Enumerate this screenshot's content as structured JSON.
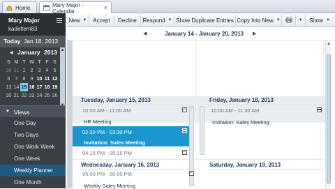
{
  "tabs": [
    {
      "label": "Home",
      "icon": "home-icon"
    },
    {
      "label": "Mary Major - Calendar",
      "icon": "calendar-icon",
      "close": "×"
    }
  ],
  "user": {
    "name": "Mary Major",
    "id": "kadeltem83"
  },
  "datebar": {
    "today_label": "Today",
    "date": "Jan 18, 2013"
  },
  "minical": {
    "month": "January",
    "year": "2013",
    "prev": "◀",
    "dow": [
      "S",
      "M",
      "T",
      "W",
      "T",
      "F",
      "S"
    ],
    "rows": [
      [
        "30",
        "31",
        "1",
        "2",
        "3",
        "4",
        "5"
      ],
      [
        "6",
        "7",
        "8",
        "9",
        "10",
        "11",
        "12"
      ],
      [
        "13",
        "14",
        "15",
        "16",
        "17",
        "18",
        "19"
      ],
      [
        "20",
        "21",
        "22",
        "23",
        "24",
        "25",
        "26"
      ]
    ]
  },
  "views": {
    "heading": "Views",
    "items": [
      "One Day",
      "Two Days",
      "One Work Week",
      "One Week",
      "Weekly Planner",
      "One Month"
    ]
  },
  "toolbar": {
    "new": "New",
    "accept": "Accept",
    "decline": "Decline",
    "respond": "Respond",
    "show_dup": "Show Duplicate Entries",
    "copy_into_new": "Copy Into New",
    "show": "Show"
  },
  "main": {
    "range_title": "January 14 - January 20, 2013",
    "prev": "◀",
    "next": "▶"
  },
  "days": {
    "tue": {
      "label": "Tuesday, January 15, 2013"
    },
    "fri": {
      "label": "Friday, January 18, 2013"
    },
    "wed": {
      "label": "Wednesday, January 16, 2013"
    },
    "sat": {
      "label": "Saturday, January 19, 2013"
    }
  },
  "events": {
    "tue1": {
      "time": "10:00 AM - 11:00 AM",
      "title": "HR Meeting"
    },
    "tue2": {
      "time": "02:30 PM - 03:30 PM",
      "title": "Invitation: Sales Meeting"
    },
    "tue3": {
      "time": "04:15 PM - 05:15 PM"
    },
    "fri1": {
      "time": "10:00 AM - 11:30 AM",
      "title": "Invitation: Sales Meeting"
    },
    "wed1": {
      "time": "05:00 PM - 06:00 PM",
      "title": "Weekly Sales Meeting"
    }
  },
  "colors": {
    "accent": "#1b96cf",
    "sidebar": "#2f3338",
    "selected_view": "#1f5a80"
  }
}
